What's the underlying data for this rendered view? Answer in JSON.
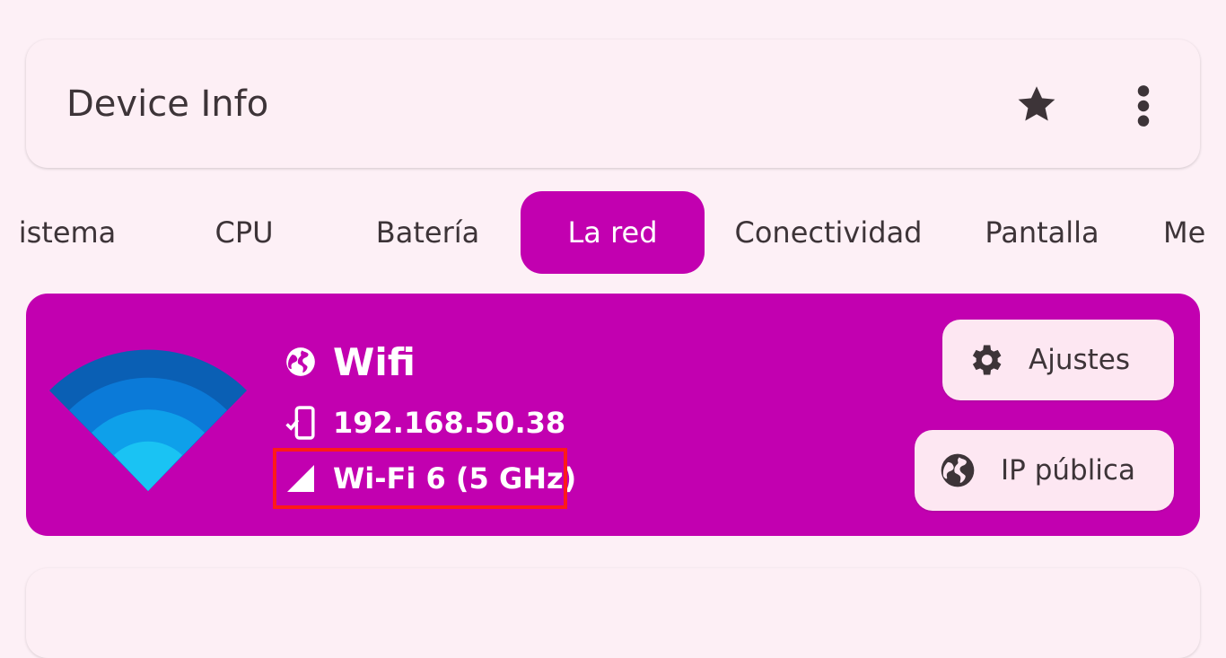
{
  "app_bar": {
    "title": "Device Info",
    "favorite_icon": "star-icon",
    "menu_icon": "more-vert-icon"
  },
  "tabs": [
    {
      "label": "Sistema",
      "visible_text": "istema",
      "active": false
    },
    {
      "label": "CPU",
      "active": false
    },
    {
      "label": "Batería",
      "active": false
    },
    {
      "label": "La red",
      "active": true
    },
    {
      "label": "Conectividad",
      "active": false
    },
    {
      "label": "Pantalla",
      "active": false
    },
    {
      "label": "Memoria",
      "visible_text": "Me",
      "active": false
    }
  ],
  "network": {
    "type_label": "Wifi",
    "type_icon": "globe-icon",
    "ip_address": "192.168.50.38",
    "ip_icon": "phone-check-icon",
    "standard": "Wi-Fi 6 (5 GHz)",
    "standard_icon": "signal-icon",
    "graphic_icon": "wifi-icon"
  },
  "actions": {
    "settings_label": "Ajustes",
    "settings_icon": "gear-icon",
    "public_ip_label": "IP pública",
    "public_ip_icon": "globe-icon"
  },
  "colors": {
    "accent": "#c200b0",
    "background": "#fdf0f6",
    "highlight": "#ff1a1a"
  }
}
